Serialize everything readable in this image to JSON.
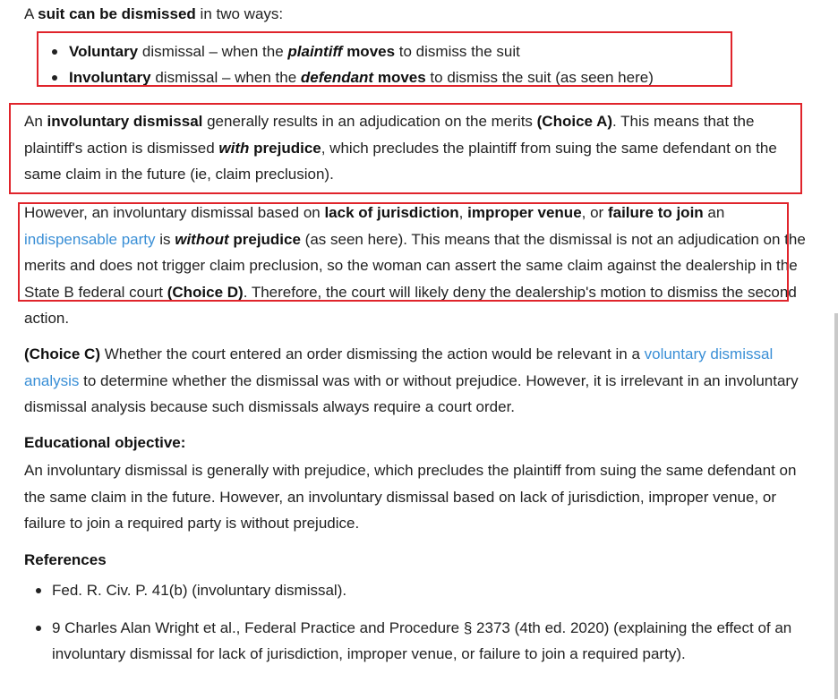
{
  "intro": {
    "pre": "A ",
    "bold": "suit can be dismissed",
    "post": " in two ways:"
  },
  "ways": [
    {
      "b1": "Voluntary",
      "t1": " dismissal – when the ",
      "bi": "plaintiff",
      "b2": " moves",
      "t2": " to dismiss the suit"
    },
    {
      "b1": "Involuntary",
      "t1": " dismissal – when the ",
      "bi": "defendant",
      "b2": " moves",
      "t2": " to dismiss the suit (as seen here)"
    }
  ],
  "para1": {
    "t1": "An ",
    "b1": "involuntary dismissal",
    "t2": " generally results in an adjudication on the merits ",
    "b2": "(Choice A)",
    "t3": ".  This means that the plaintiff's action is dismissed ",
    "bi": "with",
    "b3": " prejudice",
    "t4": ", which precludes the plaintiff from suing the same defendant on the same claim in the future (ie, claim preclusion)."
  },
  "para2": {
    "t1": "However, an involuntary dismissal based on ",
    "b1": "lack of jurisdiction",
    "t2": ", ",
    "b2": "improper venue",
    "t3": ", or ",
    "b3": "failure to join",
    "t4": " an ",
    "link": "indispensable party",
    "t5": " is ",
    "bi": "without",
    "b4": " prejudice",
    "t6": " (as seen here).  This means that the dismissal is not an adjudication on the merits and does not trigger claim preclusion, so the woman can assert the same claim against the dealership in the State B federal court ",
    "b5": "(Choice D)",
    "t7": ".  Therefore, the court will likely deny the dealership's motion to dismiss the second action."
  },
  "para3": {
    "b1": "(Choice C)",
    "t1": "  Whether the court entered an order dismissing the action would be relevant in a ",
    "link": "voluntary dismissal analysis",
    "t2": " to determine whether the dismissal was with or without prejudice.  However, it is irrelevant in an involuntary dismissal analysis because such dismissals always require a court order."
  },
  "edu": {
    "heading": "Educational objective:",
    "text": "An involuntary dismissal is generally with prejudice, which precludes the plaintiff from suing the same defendant on the same claim in the future.  However, an involuntary dismissal based on lack of jurisdiction, improper venue, or failure to join a required party is without prejudice."
  },
  "refs": {
    "heading": "References",
    "items": [
      "Fed. R. Civ. P. 41(b) (involuntary dismissal).",
      "9 Charles Alan Wright et al., Federal Practice and Procedure § 2373 (4th ed. 2020) (explaining the effect of an involuntary dismissal for lack of jurisdiction, improper venue, or failure to join a required party)."
    ]
  },
  "colors": {
    "text": "#222222",
    "link": "#3a8fd6",
    "highlight": "#e0242b"
  }
}
